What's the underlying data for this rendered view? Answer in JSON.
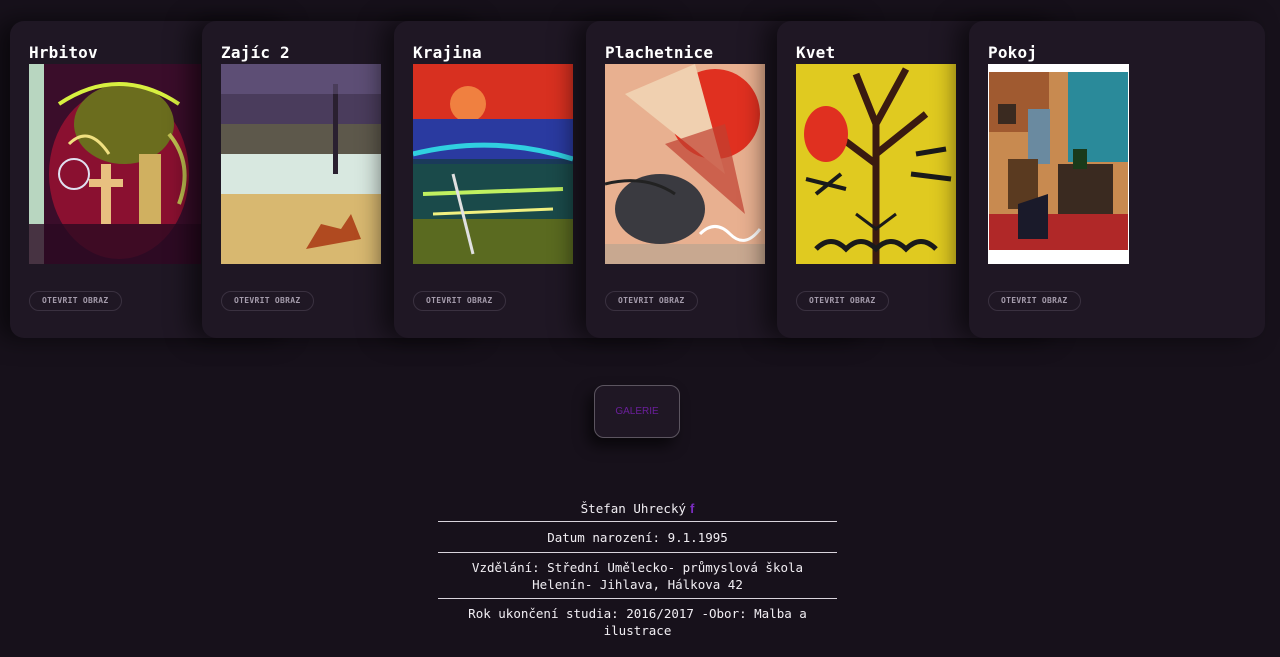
{
  "cards": [
    {
      "title": "Hrbitov",
      "button": "OTEVRIT OBRAZ",
      "image": "painting-hrbitov"
    },
    {
      "title": "Zajíc 2",
      "button": "OTEVRIT OBRAZ",
      "image": "painting-zajic"
    },
    {
      "title": "Krajina",
      "button": "OTEVRIT OBRAZ",
      "image": "painting-krajina"
    },
    {
      "title": "Plachetnice",
      "button": "OTEVRIT OBRAZ",
      "image": "painting-plachetnice"
    },
    {
      "title": "Kvet",
      "button": "OTEVRIT OBRAZ",
      "image": "painting-kvet"
    },
    {
      "title": "Pokoj",
      "button": "OTEVRIT OBRAZ",
      "image": "painting-pokoj"
    }
  ],
  "gallery_button": "GALERIE",
  "artist": {
    "name": "Štefan Uhrecký",
    "social_icon": "facebook-icon",
    "birth": "Datum narození: 9.1.1995",
    "education": "Vzdělání: Střední Umělecko- průmyslová škola Helenín- Jihlava, Hálkova 42",
    "study": "Rok ukončení studia: 2016/2017 -Obor: Malba a ilustrace"
  },
  "colors": {
    "background": "#17111b",
    "card": "#1f1724",
    "accent": "#7a2cc0",
    "gallery_text": "#6a1f9a"
  }
}
